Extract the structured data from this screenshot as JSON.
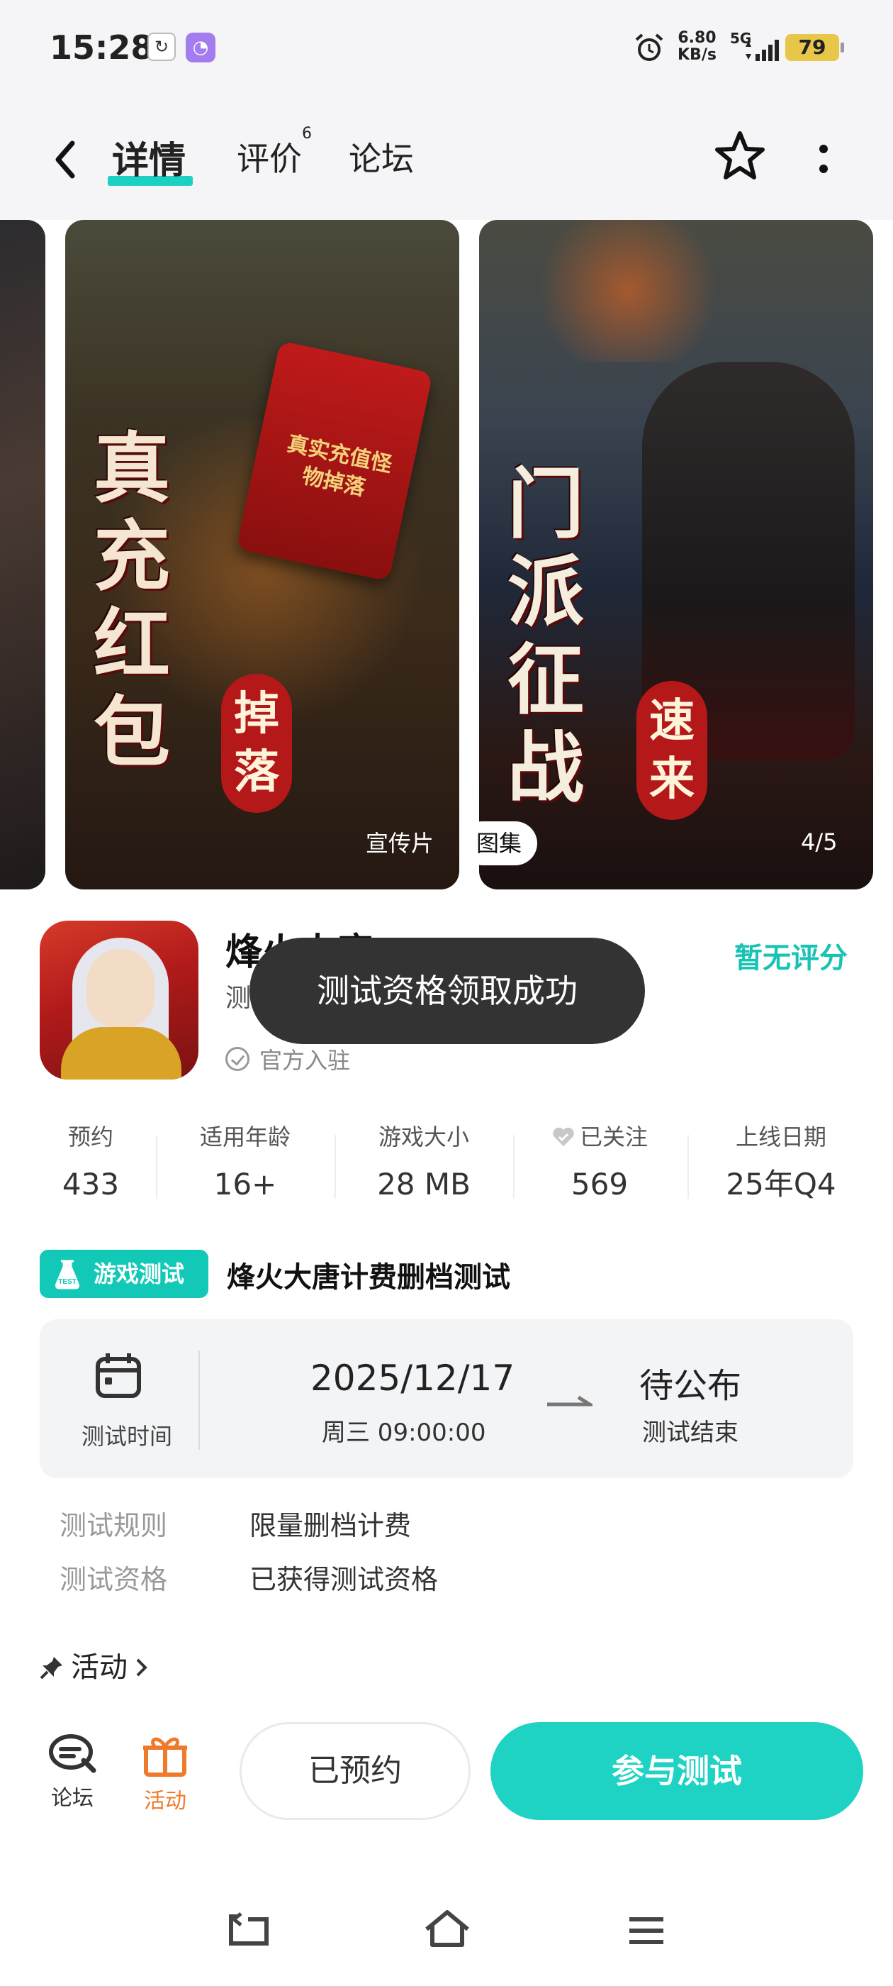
{
  "status_bar": {
    "time": "15:28",
    "speed_value": "6.80",
    "speed_unit": "KB/s",
    "network": "5G",
    "battery": "79"
  },
  "nav": {
    "tabs": [
      {
        "label": "详情"
      },
      {
        "label": "评价",
        "badge": "6"
      },
      {
        "label": "论坛"
      }
    ],
    "active_tab": "详情"
  },
  "gallery": {
    "shot1_title": "真充红包",
    "shot1_seal": "掉落",
    "shot1_packet": "真实充值怪物掉落",
    "shot2_title": "门派征战",
    "shot2_seal": "速来",
    "promo_label": "宣传片",
    "album_label": "图集",
    "counter": "4/5"
  },
  "app": {
    "name": "烽火大唐",
    "subtitle": "测",
    "official": "官方入驻",
    "rating": "暂无评分"
  },
  "toast": {
    "message": "测试资格领取成功"
  },
  "stats": [
    {
      "label": "预约",
      "value": "433"
    },
    {
      "label": "适用年龄",
      "value": "16+"
    },
    {
      "label": "游戏大小",
      "value": "28 MB"
    },
    {
      "label": "已关注",
      "value": "569"
    },
    {
      "label": "上线日期",
      "value": "25年Q4"
    }
  ],
  "test": {
    "badge": "游戏测试",
    "badge_icon_text": "TEST",
    "title": "烽火大唐计费删档测试",
    "time_label": "测试时间",
    "start_date": "2025/12/17",
    "start_time": "周三  09:00:00",
    "end_status": "待公布",
    "end_label": "测试结束",
    "rules": [
      {
        "key": "测试规则",
        "value": "限量删档计费"
      },
      {
        "key": "测试资格",
        "value": "已获得测试资格"
      }
    ]
  },
  "activity": {
    "label": "活动"
  },
  "action_bar": {
    "forum_label": "论坛",
    "activity_label": "活动",
    "reserved_label": "已预约",
    "join_label": "参与测试"
  },
  "colors": {
    "accent": "#1ed3c3",
    "activity": "#f07a2c",
    "toast_bg": "#333333"
  }
}
